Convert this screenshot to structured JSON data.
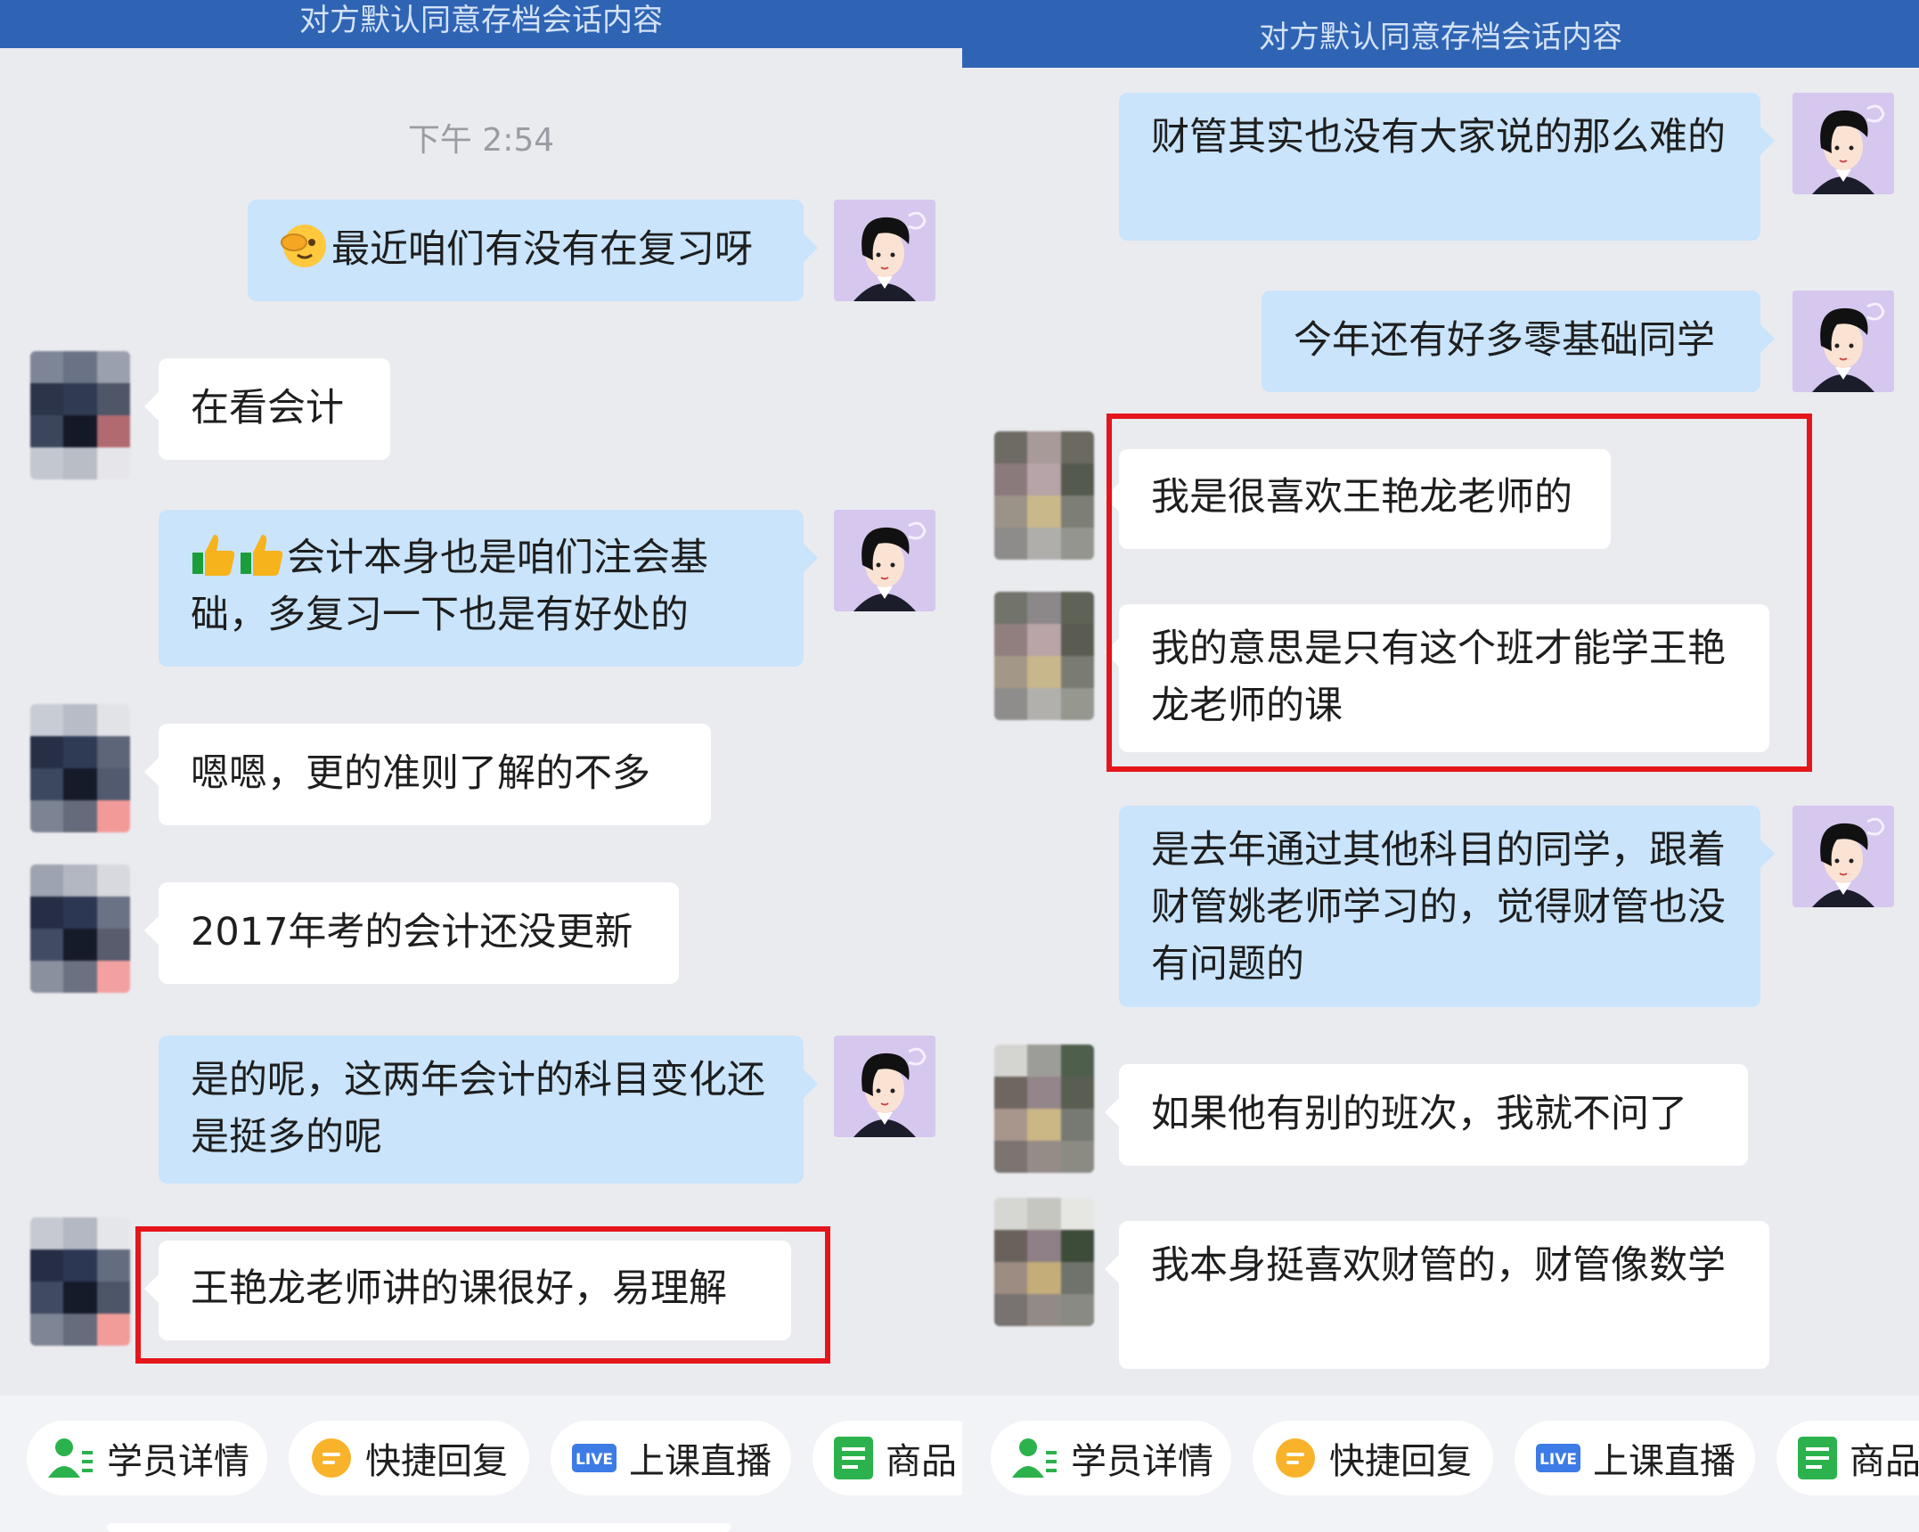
{
  "banner_text": "对方默认同意存档会话内容",
  "left_panel": {
    "timestamp": "下午 2:54",
    "messages": [
      {
        "sender": "advisor",
        "text": "最近咱们有没有在复习呀"
      },
      {
        "sender": "student",
        "text": "在看会计"
      },
      {
        "sender": "advisor",
        "text": "会计本身也是咱们注会基础，多复习一下也是有好处的"
      },
      {
        "sender": "student",
        "text": "嗯嗯，更的准则了解的不多"
      },
      {
        "sender": "student",
        "text": "2017年考的会计还没更新"
      },
      {
        "sender": "advisor",
        "text": "是的呢，这两年会计的科目变化还是挺多的呢"
      },
      {
        "sender": "student",
        "text": "王艳龙老师讲的课很好，易理解",
        "highlighted": true
      }
    ]
  },
  "right_panel": {
    "messages": [
      {
        "sender": "advisor",
        "text": "财管其实也没有大家说的那么难的"
      },
      {
        "sender": "advisor",
        "text": "今年还有好多零基础同学"
      },
      {
        "sender": "student",
        "text": "我是很喜欢王艳龙老师的",
        "highlighted": true
      },
      {
        "sender": "student",
        "text": "我的意思是只有这个班才能学王艳龙老师的课",
        "highlighted": true
      },
      {
        "sender": "advisor",
        "text": "是去年通过其他科目的同学，跟着财管姚老师学习的，觉得财管也没有问题的"
      },
      {
        "sender": "student",
        "text": "如果他有别的班次，我就不问了"
      },
      {
        "sender": "student",
        "text": "我本身挺喜欢财管的，财管像数学"
      }
    ]
  },
  "toolbar": {
    "student_details": "学员详情",
    "quick_reply": "快捷回复",
    "live_class": "上课直播",
    "live_badge": "LIVE",
    "products": "商品"
  },
  "icons": {
    "student": "person-icon",
    "quick_reply": "quick-reply-icon",
    "live": "live-icon",
    "products": "product-list-icon",
    "eye_covering_emoji": "face-covering-eye-emoji",
    "thumbs_up_emoji": "thumbs-up-emoji"
  },
  "colors": {
    "banner": "#2f64b4",
    "advisor_bubble": "#c9e4fb",
    "student_bubble": "#ffffff",
    "highlight_box": "#e4161c",
    "icon_green": "#2bb24c",
    "icon_yellow": "#f9b32a",
    "icon_blue": "#3d7be6"
  }
}
